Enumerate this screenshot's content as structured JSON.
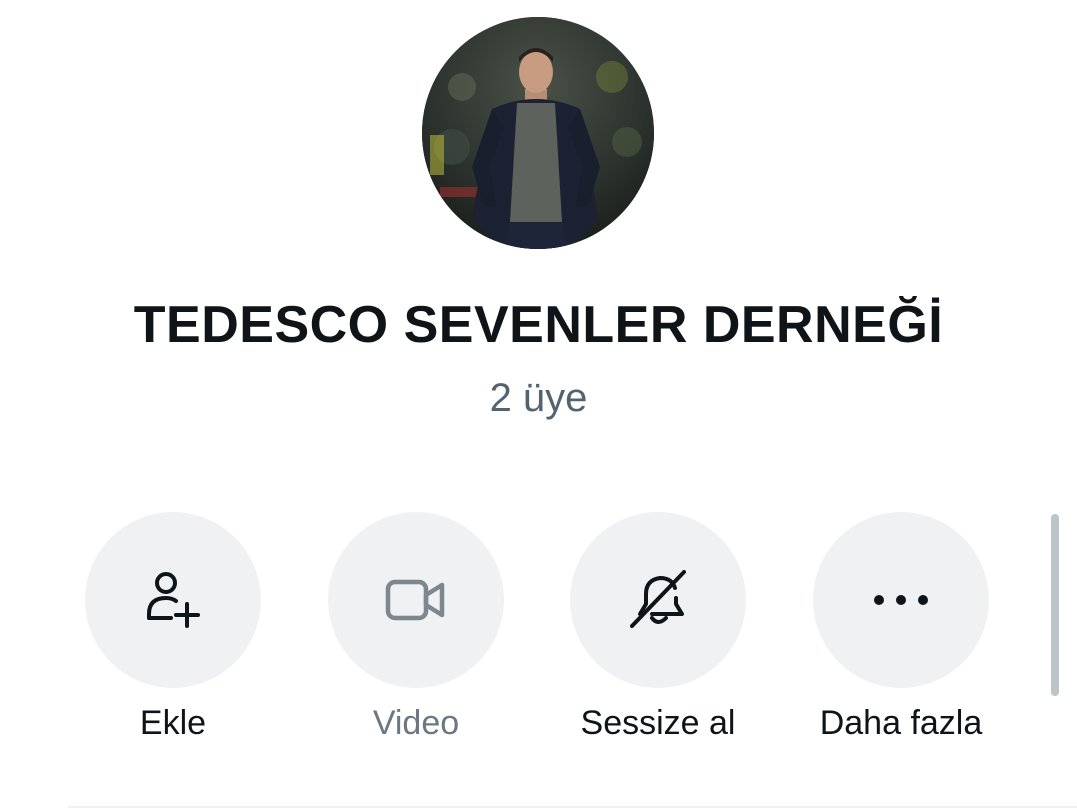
{
  "group": {
    "name": "TEDESCO SEVENLER DERNEĞİ",
    "member_count": "2 üye"
  },
  "actions": [
    {
      "label": "Ekle",
      "icon": "add-person-icon"
    },
    {
      "label": "Video",
      "icon": "video-camera-icon",
      "disabled": true
    },
    {
      "label": "Sessize al",
      "icon": "bell-off-icon"
    },
    {
      "label": "Daha fazla",
      "icon": "more-dots-icon"
    }
  ],
  "colors": {
    "text_primary": "#0f1419",
    "text_secondary": "#536471",
    "button_bg": "#eff1f2",
    "disabled_icon": "#7d8790"
  }
}
